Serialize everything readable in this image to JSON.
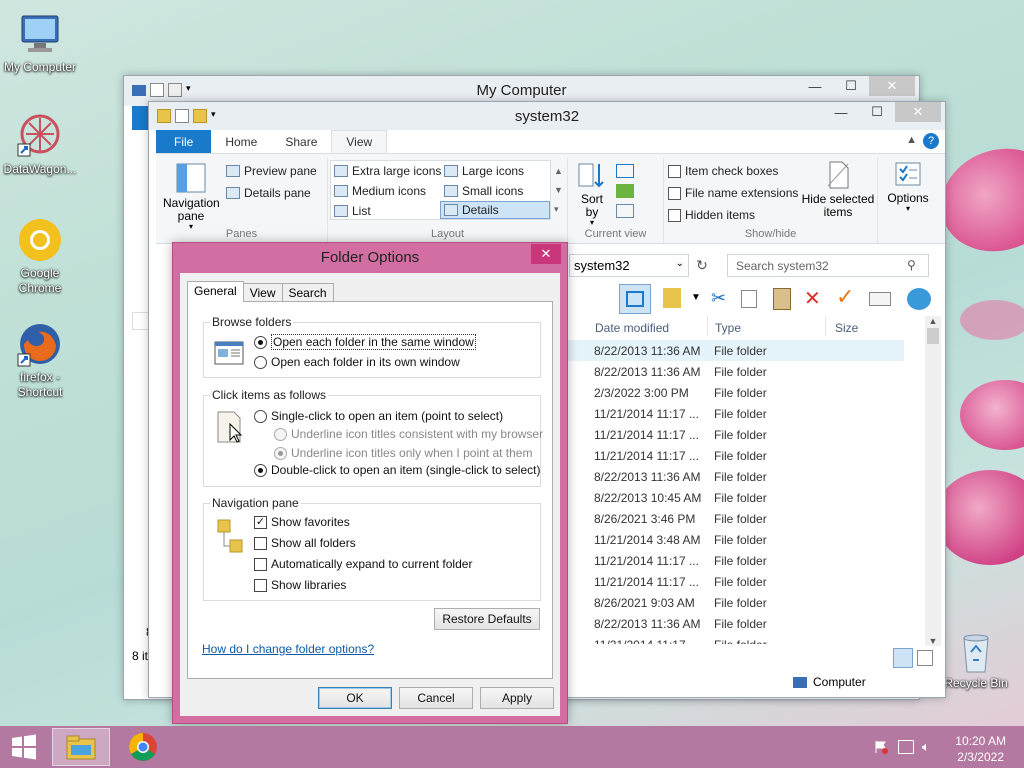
{
  "desktop": {
    "icons": [
      {
        "label": "My Computer"
      },
      {
        "label": "DataWagon..."
      },
      {
        "label": "Google Chrome"
      },
      {
        "label": "firefox - Shortcut"
      },
      {
        "label": "Recycle Bin"
      }
    ]
  },
  "my_computer_window": {
    "title": "My Computer",
    "status_item_count": "8 it",
    "status_prefix": "Da",
    "number_fragment": "8"
  },
  "explorer": {
    "title": "system32",
    "tabs": [
      "File",
      "Home",
      "Share",
      "View"
    ],
    "ribbon": {
      "panes": {
        "label": "Panes",
        "navigation_pane": "Navigation pane",
        "preview_pane": "Preview pane",
        "details_pane": "Details pane"
      },
      "layout": {
        "label": "Layout",
        "items": [
          "Extra large icons",
          "Large icons",
          "Medium icons",
          "Small icons",
          "List",
          "Details"
        ],
        "selected": "Details"
      },
      "current_view": {
        "label": "Current view",
        "sort_by": "Sort by"
      },
      "show_hide": {
        "label": "Show/hide",
        "item_check_boxes": "Item check boxes",
        "file_name_extensions": "File name extensions",
        "hidden_items": "Hidden items",
        "hide_selected": "Hide selected items"
      },
      "options": "Options"
    },
    "address": "system32",
    "search_placeholder": "Search system32",
    "columns": {
      "date": "Date modified",
      "type": "Type",
      "size": "Size"
    },
    "rows": [
      {
        "date": "8/22/2013 11:36 AM",
        "type": "File folder"
      },
      {
        "date": "8/22/2013 11:36 AM",
        "type": "File folder"
      },
      {
        "date": "2/3/2022 3:00 PM",
        "type": "File folder"
      },
      {
        "date": "11/21/2014 11:17 ...",
        "type": "File folder"
      },
      {
        "date": "11/21/2014 11:17 ...",
        "type": "File folder"
      },
      {
        "date": "11/21/2014 11:17 ...",
        "type": "File folder"
      },
      {
        "date": "8/22/2013 11:36 AM",
        "type": "File folder"
      },
      {
        "date": "8/22/2013 10:45 AM",
        "type": "File folder"
      },
      {
        "date": "8/26/2021 3:46 PM",
        "type": "File folder"
      },
      {
        "date": "11/21/2014 3:48 AM",
        "type": "File folder"
      },
      {
        "date": "11/21/2014 11:17 ...",
        "type": "File folder"
      },
      {
        "date": "11/21/2014 11:17 ...",
        "type": "File folder"
      },
      {
        "date": "8/26/2021 9:03 AM",
        "type": "File folder"
      },
      {
        "date": "8/22/2013 11:36 AM",
        "type": "File folder"
      },
      {
        "date": "11/21/2014 11:17 ...",
        "type": "File folder"
      }
    ],
    "status_location": "Computer"
  },
  "folder_options": {
    "title": "Folder Options",
    "tabs": [
      "General",
      "View",
      "Search"
    ],
    "browse_folders": {
      "legend": "Browse folders",
      "same_window": "Open each folder in the same window",
      "own_window": "Open each folder in its own window",
      "selected": "same_window"
    },
    "click_items": {
      "legend": "Click items as follows",
      "single_click": "Single-click to open an item (point to select)",
      "underline_browser": "Underline icon titles consistent with my browser",
      "underline_point": "Underline icon titles only when I point at them",
      "double_click": "Double-click to open an item (single-click to select)",
      "selected": "double_click"
    },
    "navigation_pane": {
      "legend": "Navigation pane",
      "show_favorites": "Show favorites",
      "show_all_folders": "Show all folders",
      "auto_expand": "Automatically expand to current folder",
      "show_libraries": "Show libraries",
      "checked": [
        "show_favorites"
      ]
    },
    "restore_defaults": "Restore Defaults",
    "help_link": "How do I change folder options?",
    "ok": "OK",
    "cancel": "Cancel",
    "apply": "Apply"
  },
  "taskbar": {
    "time": "10:20 AM",
    "date": "2/3/2022"
  },
  "colors": {
    "accent": "#1979ca",
    "dialog_frame": "#d36ea3",
    "taskbar": "#b479a1"
  }
}
